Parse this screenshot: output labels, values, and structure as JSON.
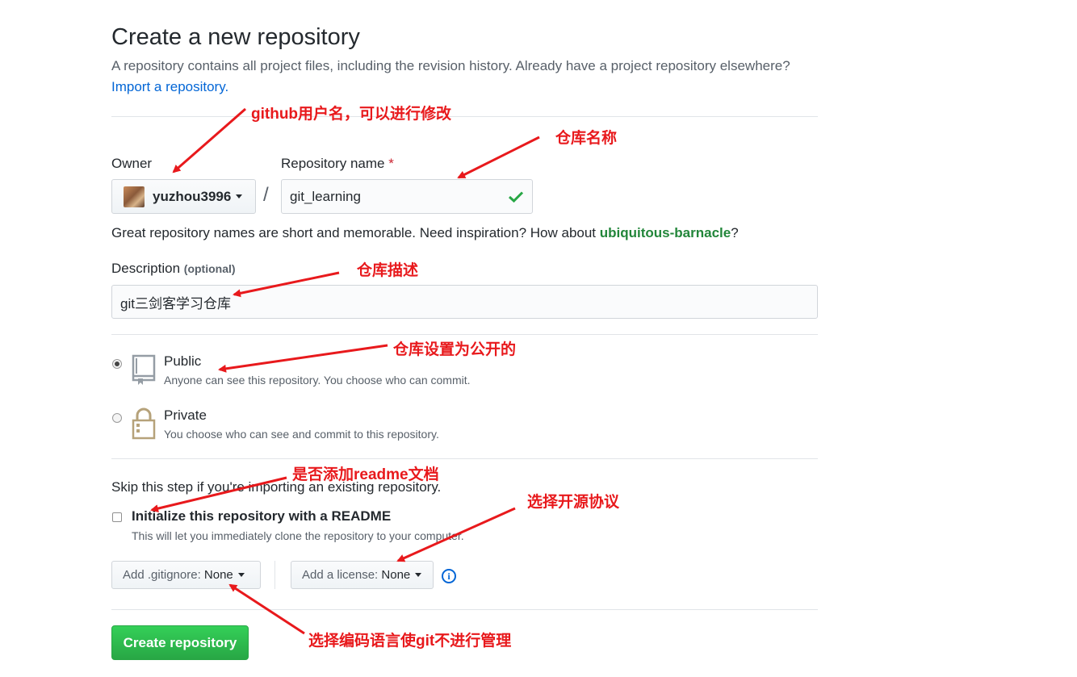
{
  "header": {
    "title": "Create a new repository",
    "subtitle": "A repository contains all project files, including the revision history. Already have a project repository elsewhere?",
    "import_link": "Import a repository."
  },
  "owner": {
    "label": "Owner",
    "value": "yuzhou3996"
  },
  "repo_name": {
    "label": "Repository name",
    "required_mark": "*",
    "value": "git_learning",
    "separator": "/"
  },
  "suggestion": {
    "text": "Great repository names are short and memorable. Need inspiration? How about",
    "name": "ubiquitous-barnacle",
    "end": "?"
  },
  "description": {
    "label": "Description",
    "optional": "(optional)",
    "value": "git三剑客学习仓库"
  },
  "visibility": {
    "public_label": "Public",
    "public_desc": "Anyone can see this repository. You choose who can commit.",
    "private_label": "Private",
    "private_desc": "You choose who can see and commit to this repository.",
    "selected": "Public"
  },
  "init": {
    "skip_text": "Skip this step if you're importing an existing repository.",
    "readme_label": "Initialize this repository with a README",
    "readme_desc": "This will let you immediately clone the repository to your computer.",
    "readme_checked": false
  },
  "gitignore": {
    "label": "Add .gitignore:",
    "value": "None"
  },
  "license": {
    "label": "Add a license:",
    "value": "None"
  },
  "submit": {
    "label": "Create repository"
  },
  "annotations": {
    "owner_note": "github用户名，可以进行修改",
    "repo_note": "仓库名称",
    "desc_note": "仓库描述",
    "public_note": "仓库设置为公开的",
    "readme_note": "是否添加readme文档",
    "license_note": "选择开源协议",
    "gitignore_note": "选择编码语言使git不进行管理"
  },
  "colors": {
    "annotation": "#e8191c",
    "link": "#0366d6",
    "suggestion": "#22863a",
    "primary_button": "#28a745"
  },
  "icons": {
    "valid": "check-icon",
    "public": "repo-book-icon",
    "private": "lock-icon",
    "info": "info-icon"
  }
}
